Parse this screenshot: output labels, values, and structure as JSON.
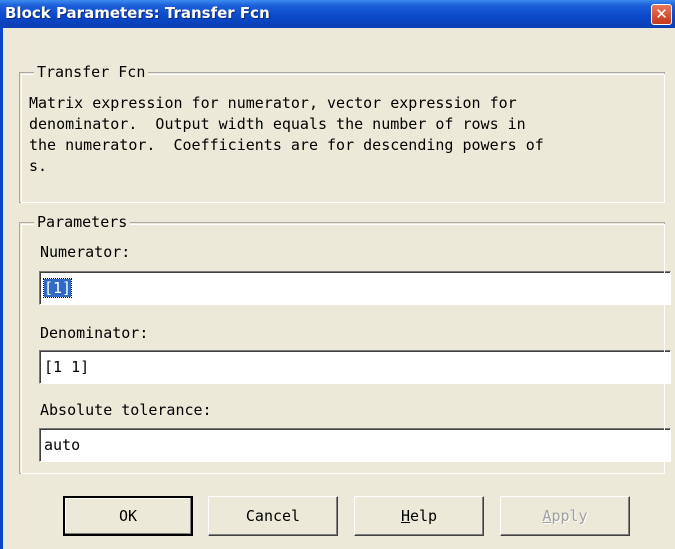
{
  "window": {
    "title": "Block Parameters: Transfer Fcn",
    "close_glyph": "✕"
  },
  "description_group": {
    "legend": "Transfer Fcn",
    "text": "Matrix expression for numerator, vector expression for\ndenominator.  Output width equals the number of rows in\nthe numerator.  Coefficients are for descending powers of\ns."
  },
  "parameters_group": {
    "legend": "Parameters",
    "numerator_label": "Numerator:",
    "numerator_value": "[1]",
    "denominator_label": "Denominator:",
    "denominator_value": "[1 1]",
    "tolerance_label": "Absolute tolerance:",
    "tolerance_value": "auto"
  },
  "buttons": {
    "ok": "OK",
    "cancel": "Cancel",
    "help": "Help",
    "apply": "Apply"
  },
  "colors": {
    "titlebar": "#0a47c9",
    "dialog_bg": "#ece9d8",
    "selection": "#316ac5"
  }
}
